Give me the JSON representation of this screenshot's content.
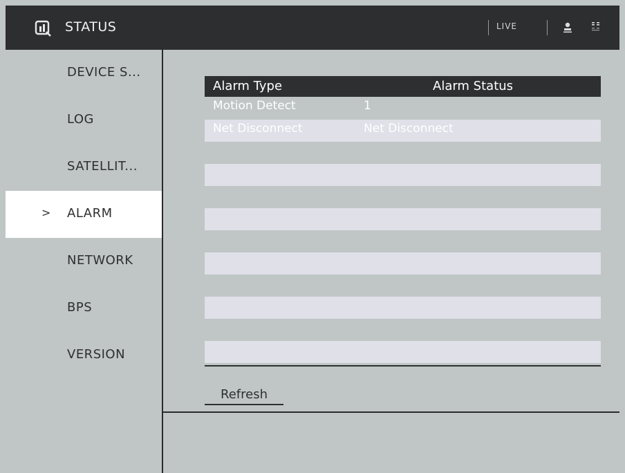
{
  "header": {
    "title": "STATUS",
    "live_label": "LIVE",
    "icons": [
      "status-logo-icon",
      "user-icon",
      "language-icon"
    ]
  },
  "sidebar": {
    "items": [
      {
        "label": "DEVICE S...",
        "active": false
      },
      {
        "label": "LOG",
        "active": false
      },
      {
        "label": "SATELLIT...",
        "active": false
      },
      {
        "label": "ALARM",
        "active": true
      },
      {
        "label": "NETWORK",
        "active": false
      },
      {
        "label": "BPS",
        "active": false
      },
      {
        "label": "VERSION",
        "active": false
      }
    ],
    "active_marker": ">"
  },
  "table": {
    "columns": [
      "Alarm Type",
      "Alarm Status"
    ],
    "rows": [
      [
        "Motion Detect",
        "1"
      ],
      [
        "Net Disconnect",
        "Net Disconnect"
      ]
    ]
  },
  "buttons": {
    "refresh_label": "Refresh"
  },
  "colors": {
    "header_bg": "#2d2e30",
    "panel_bg": "#bfc6c5",
    "active_item_bg": "#ffffff",
    "row_stripe": "#dfe0e8"
  }
}
